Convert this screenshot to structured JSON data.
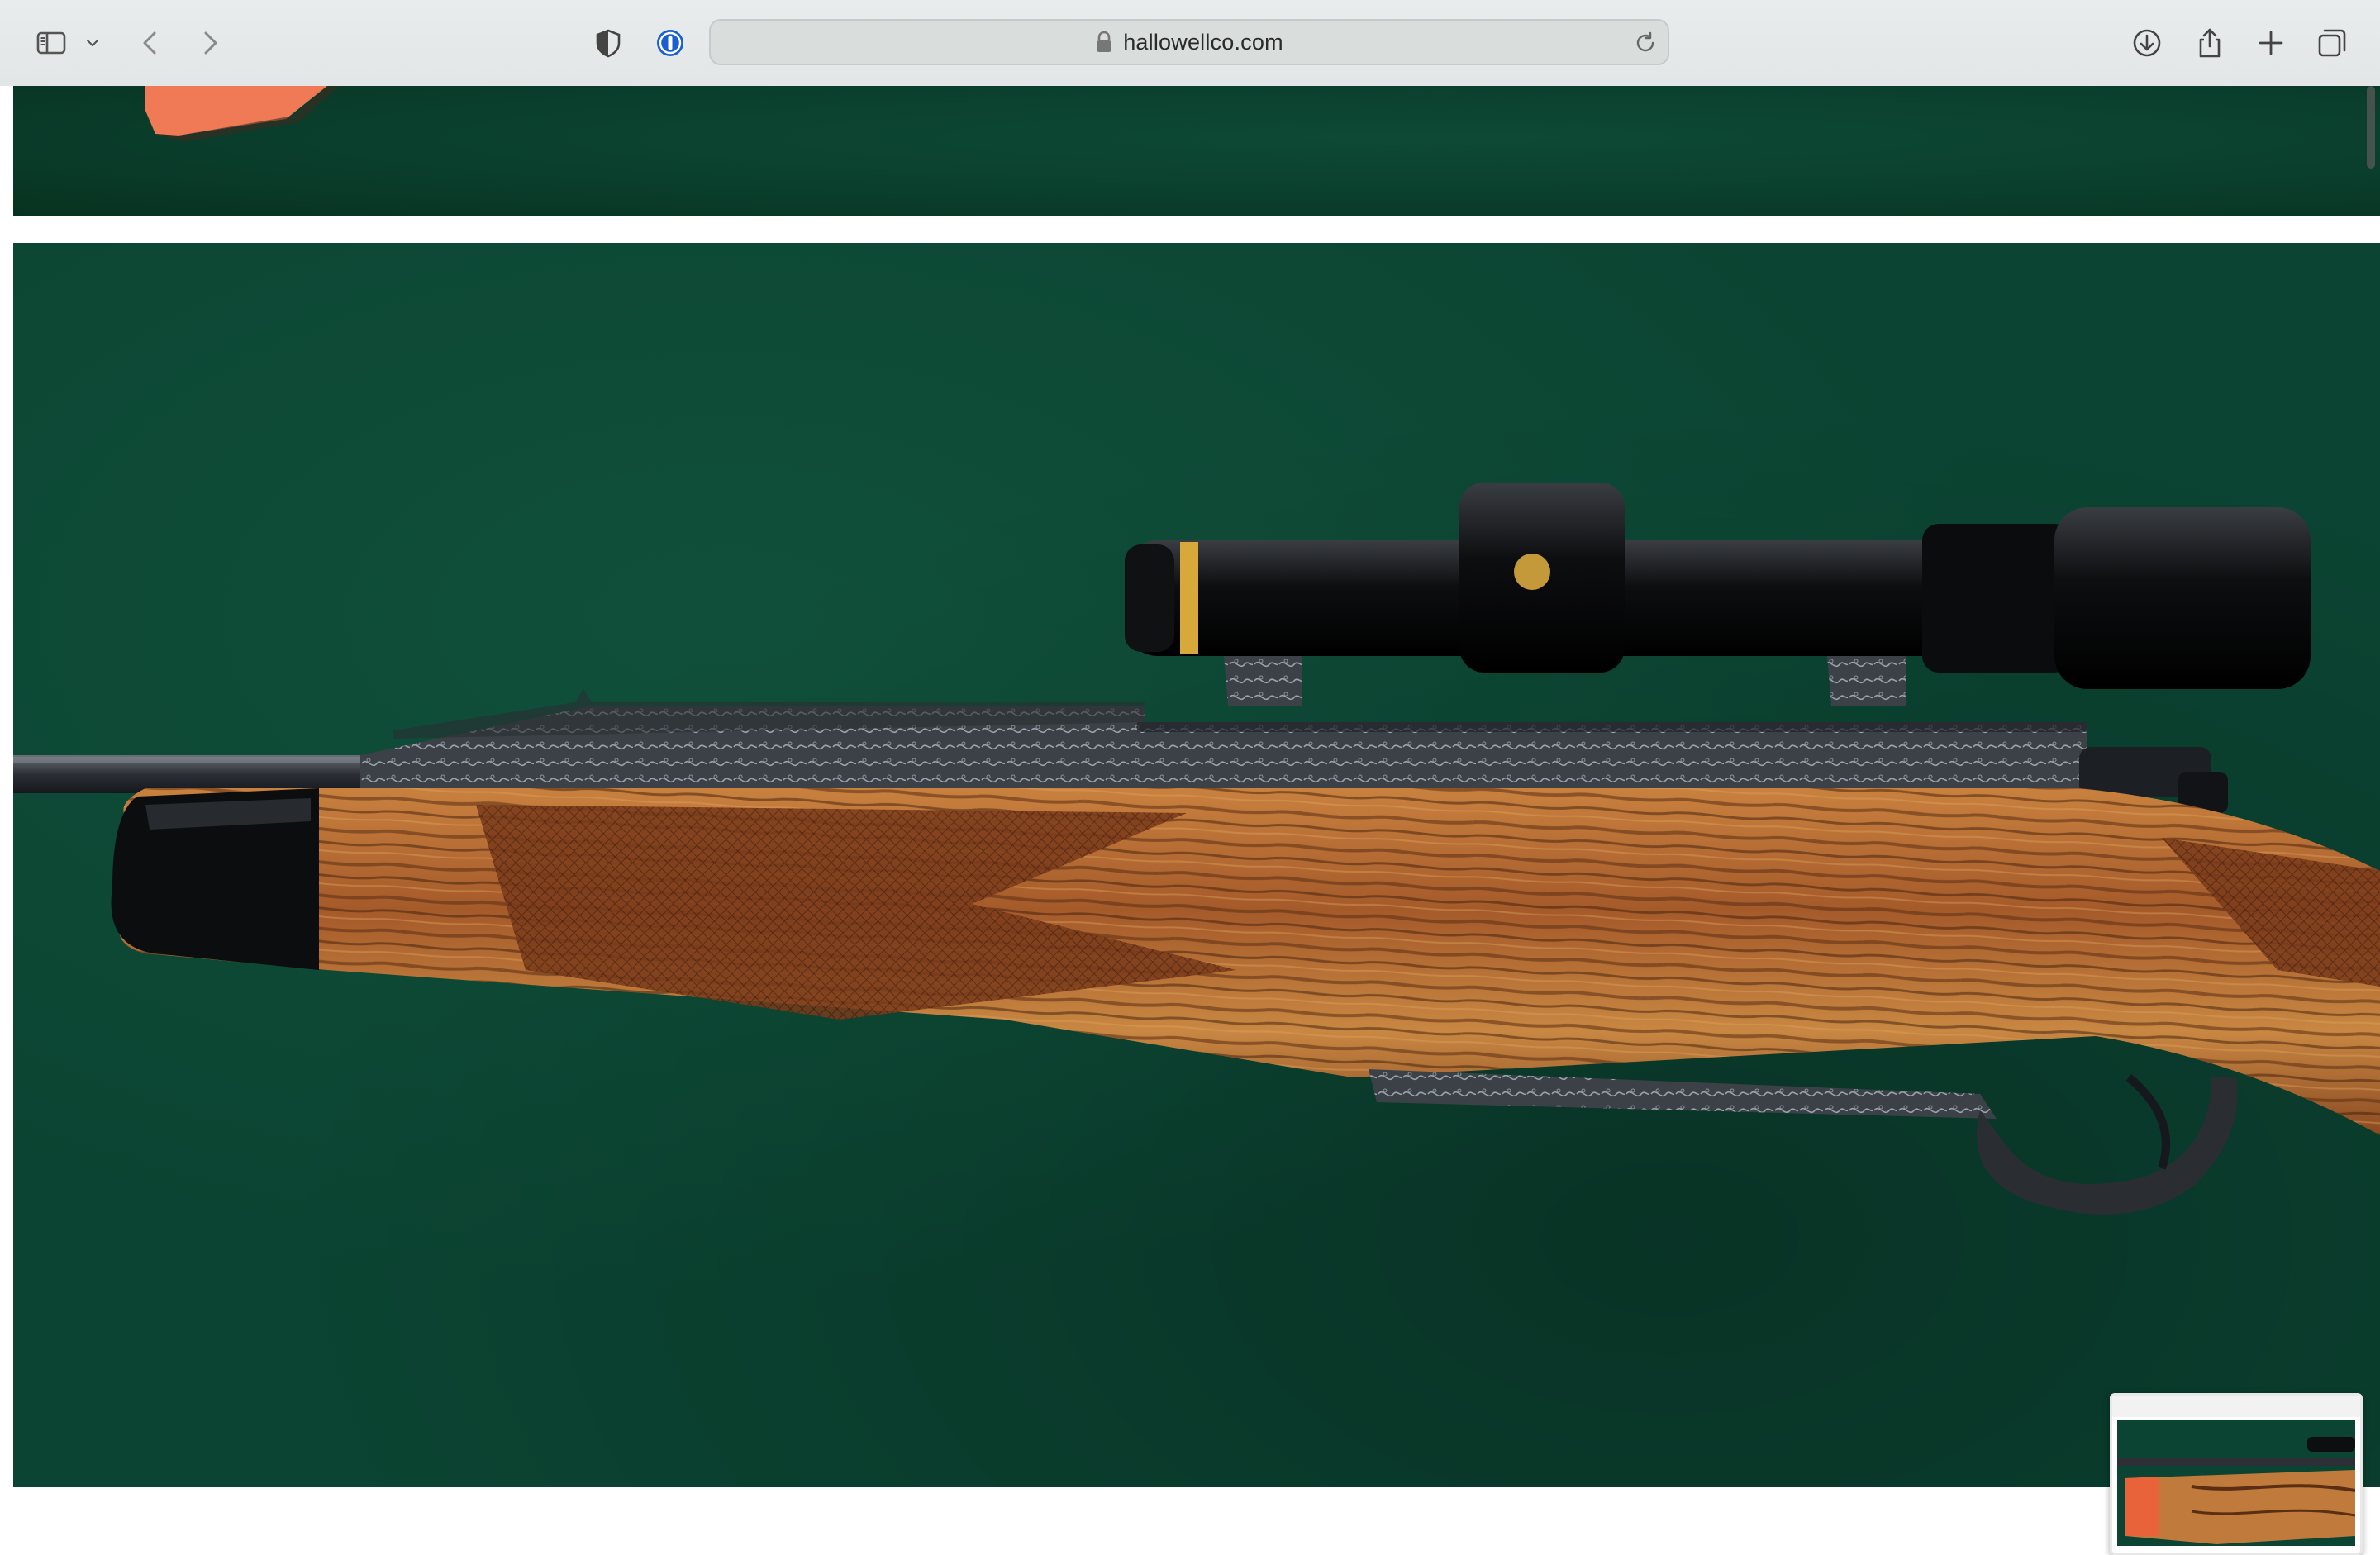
{
  "browser": {
    "url": "hallowellco.com",
    "icons": {
      "sidebar": "sidebar-toggle-icon",
      "chevron": "chevron-down-icon",
      "back": "back-arrow-icon",
      "forward": "forward-arrow-icon",
      "privacy": "privacy-shield-icon",
      "password": "password-manager-icon",
      "lock": "lock-icon",
      "reload": "reload-icon",
      "download": "download-icon",
      "share": "share-icon",
      "new_tab": "plus-icon",
      "tabs": "tab-overview-icon"
    }
  },
  "page": {
    "photo_subject": "rifle-with-scope",
    "background_color": "#0b4432"
  }
}
